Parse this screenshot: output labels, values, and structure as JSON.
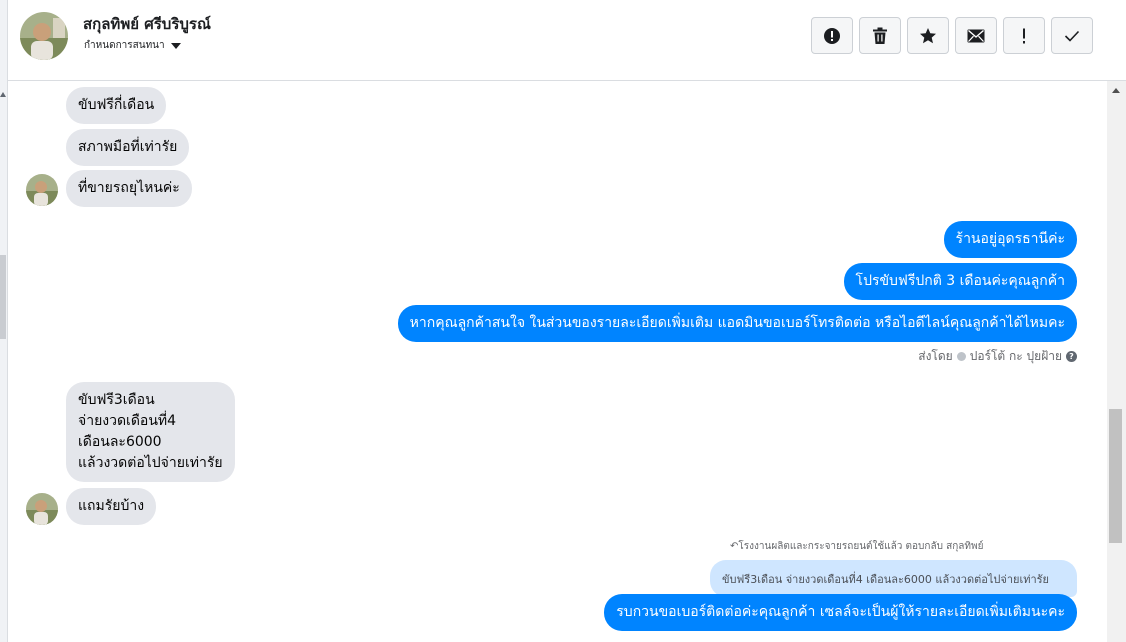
{
  "header": {
    "contact_name": "สกุลทิพย์ ศรีบริบูรณ์",
    "assign_label": "กำหนดการสนทนา",
    "actions": [
      {
        "name": "spam-button",
        "icon": "alert-circle-icon"
      },
      {
        "name": "delete-button",
        "icon": "trash-icon"
      },
      {
        "name": "star-button",
        "icon": "star-icon"
      },
      {
        "name": "mark-unread-button",
        "icon": "envelope-icon"
      },
      {
        "name": "important-button",
        "icon": "exclamation-icon"
      },
      {
        "name": "done-button",
        "icon": "check-icon"
      }
    ]
  },
  "messages": {
    "m1": "ขับฟรีกี่เดือน",
    "m2": "สภาพมือที่เท่ารัย",
    "m3": "ที่ขายรถยุไหนค่ะ",
    "m4": "ร้านอยู่อุดรธานีค่ะ",
    "m5": "โปรขับฟรีปกติ 3 เดือนค่ะคุณลูกค้า",
    "m6": "หากคุณลูกค้าสนใจ ในส่วนของรายละเอียดเพิ่มเติม แอดมินขอเบอร์โทรติดต่อ หรือไอดีไลน์คุณลูกค้าได้ไหมคะ",
    "sent_by_prefix": "ส่งโดย",
    "sent_by_name": "ปอร์โต้ กะ ปุยฝ้าย",
    "m7_lines": [
      "ขับฟรี3เดือน",
      "จ่ายงวดเดือนที่4",
      "เดือนละ6000",
      "แล้วงวดต่อไปจ่ายเท่ารัย"
    ],
    "m8": "แถมรัยบ้าง",
    "reply_note": "โรงงานผลิตและกระจายรถยนต์ใช้แล้ว ตอบกลับ สกุลทิพย์",
    "quoted": "ขับฟรี3เดือน จ่ายงวดเดือนที่4 เดือนละ6000 แล้วงวดต่อไปจ่ายเท่ารัย",
    "m9": "รบกวนขอเบอร์ติดต่อค่ะคุณลูกค้า เซลล์จะเป็นผู้ให้รายละเอียดเพิ่มเติมนะคะ"
  },
  "colors": {
    "outgoing": "#0084ff",
    "incoming": "#e4e6eb",
    "quoted": "#cfe6ff"
  }
}
